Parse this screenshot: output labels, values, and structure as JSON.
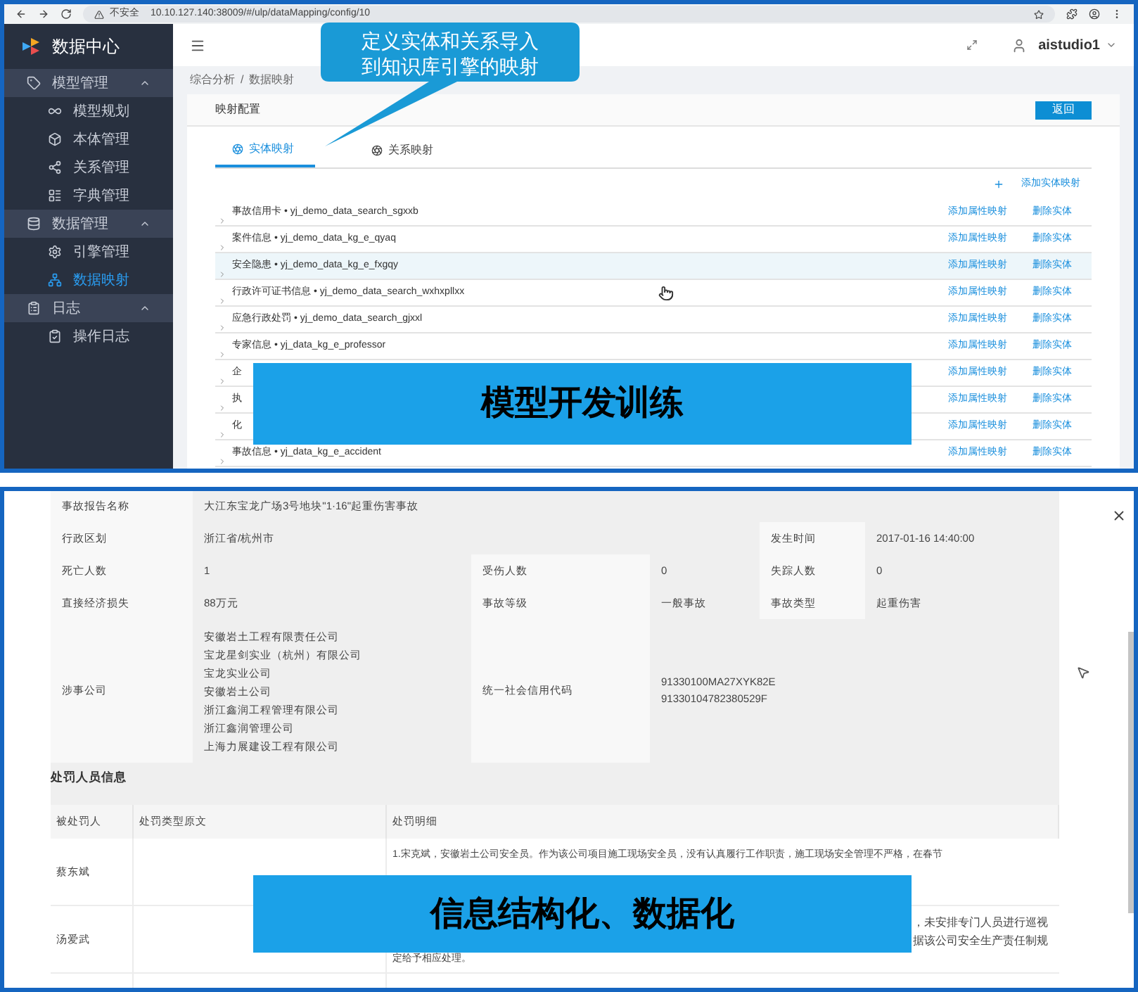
{
  "browser": {
    "security": "不安全",
    "url": "10.10.127.140:38009/#/ulp/dataMapping/config/10"
  },
  "callout": {
    "lines": [
      "定义实体和关系导入",
      "到知识库引擎的映射"
    ]
  },
  "app": {
    "title": "数据中心",
    "user": "aistudio1"
  },
  "sidebar": [
    {
      "label": "模型管理",
      "expanded": true,
      "items": [
        {
          "label": "模型规划",
          "selected": false
        },
        {
          "label": "本体管理",
          "selected": false
        },
        {
          "label": "关系管理",
          "selected": false
        },
        {
          "label": "字典管理",
          "selected": false
        }
      ]
    },
    {
      "label": "数据管理",
      "expanded": true,
      "items": [
        {
          "label": "引擎管理",
          "selected": false
        },
        {
          "label": "数据映射",
          "selected": true
        }
      ]
    },
    {
      "label": "日志",
      "expanded": true,
      "items": [
        {
          "label": "操作日志",
          "selected": false
        }
      ]
    }
  ],
  "breadcrumb": [
    "综合分析",
    "/",
    "数据映射"
  ],
  "card": {
    "title": "映射配置",
    "back_button": "返回",
    "add_link": "添加实体映射"
  },
  "tabs": [
    {
      "label": "实体映射",
      "selected": true
    },
    {
      "label": "关系映射",
      "selected": false
    }
  ],
  "entities": [
    {
      "name": "事故信用卡 • yj_demo_data_search_sgxxb",
      "selected": false,
      "actions": [
        "添加属性映射",
        "删除实体"
      ]
    },
    {
      "name": "案件信息 • yj_demo_data_kg_e_qyaq",
      "selected": false,
      "actions": [
        "添加属性映射",
        "删除实体"
      ]
    },
    {
      "name": "安全隐患 • yj_demo_data_kg_e_fxgqy",
      "selected": true,
      "actions": [
        "添加属性映射",
        "删除实体"
      ]
    },
    {
      "name": "行政许可证书信息 • yj_demo_data_search_wxhxpllxx",
      "selected": false,
      "actions": [
        "添加属性映射",
        "删除实体"
      ]
    },
    {
      "name": "应急行政处罚 • yj_demo_data_search_gjxxl",
      "selected": false,
      "actions": [
        "添加属性映射",
        "删除实体"
      ]
    },
    {
      "name": "专家信息 • yj_data_kg_e_professor",
      "selected": false,
      "actions": [
        "添加属性映射",
        "删除实体"
      ]
    },
    {
      "name": "企",
      "selected": false,
      "actions": [
        "添加属性映射",
        "删除实体"
      ]
    },
    {
      "name": "执",
      "selected": false,
      "actions": [
        "添加属性映射",
        "删除实体"
      ]
    },
    {
      "name": "化",
      "selected": false,
      "actions": [
        "添加属性映射",
        "删除实体"
      ]
    },
    {
      "name": "事故信息 • yj_data_kg_e_accident",
      "selected": false,
      "actions": [
        "添加属性映射",
        "删除实体"
      ]
    }
  ],
  "banners": [
    "模型开发训练",
    "信息结构化、数据化"
  ],
  "report": {
    "name_label": "事故报告名称",
    "name": "大江东宝龙广场3号地块\"1·16\"起重伤害事故",
    "region_label": "行政区划",
    "region": "浙江省/杭州市",
    "time_label": "发生时间",
    "time": "2017-01-16 14:40:00",
    "deaths_label": "死亡人数",
    "deaths": "1",
    "injured_label": "受伤人数",
    "injured": "0",
    "missing_label": "失踪人数",
    "missing": "0",
    "loss_label": "直接经济损失",
    "loss": "88万元",
    "level_label": "事故等级",
    "level_value": "一般事故",
    "type_label": "事故类型",
    "type": "起重伤害",
    "companies_label": "涉事公司",
    "companies": [
      "安徽岩土工程有限责任公司",
      "宝龙星剑实业（杭州）有限公司",
      "宝龙实业公司",
      "安徽岩土公司",
      "浙江鑫润工程管理有限公司",
      "浙江鑫润管理公司",
      "上海力展建设工程有限公司"
    ],
    "codes_label": "统一社会信用代码",
    "codes": [
      "91330100MA27XYK82E",
      "91330104782380529F"
    ]
  },
  "penalty": {
    "title": "处罚人员信息",
    "columns": [
      "被处罚人",
      "处罚类型原文",
      "处罚明细"
    ],
    "rows": [
      {
        "person": "蔡东斌",
        "lines": [
          {
            "kind": "full",
            "text": "1.宋克斌，安徽岩土公司安全员。作为该公司项目施工现场安全员，没有认真履行工作职责，施工现场安全管理不严格，在春节"
          }
        ]
      },
      {
        "person": "汤爱武",
        "lines": [
          {
            "kind": "tail",
            "text": "，未安排专门人员进行巡视"
          },
          {
            "kind": "tail",
            "text": "据该公司安全生产责任制规"
          },
          {
            "kind": "full",
            "text": "定给予相应处理。"
          }
        ]
      }
    ]
  }
}
